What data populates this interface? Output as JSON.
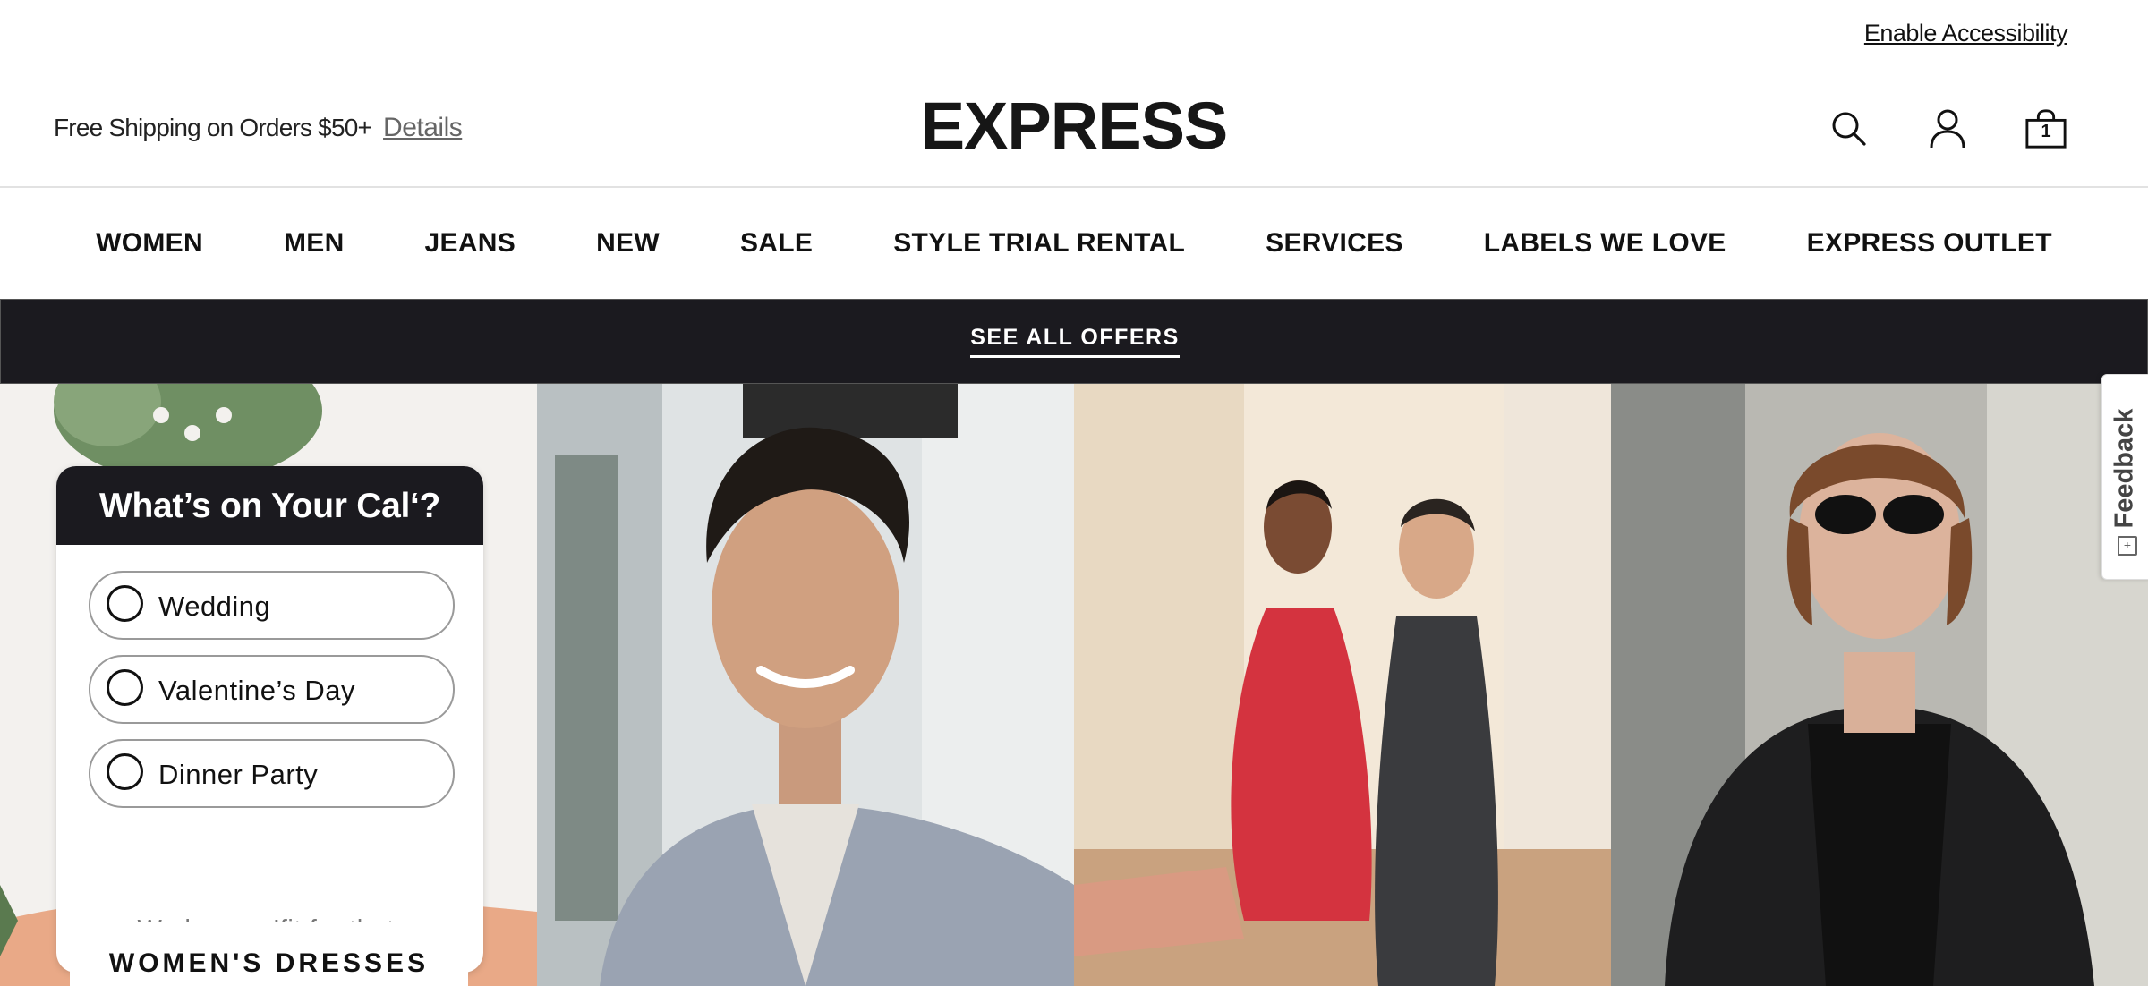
{
  "utility": {
    "enable_accessibility": "Enable Accessibility"
  },
  "header": {
    "shipping_text": "Free Shipping on Orders $50+",
    "details_link": "Details",
    "logo": "EXPRESS",
    "icons": [
      "search-icon",
      "account-icon",
      "bag-icon"
    ],
    "bag_count": "1"
  },
  "nav": {
    "items": [
      "WOMEN",
      "MEN",
      "JEANS",
      "NEW",
      "SALE",
      "STYLE TRIAL RENTAL",
      "SERVICES",
      "LABELS WE LOVE",
      "EXPRESS OUTLET"
    ]
  },
  "offers_bar": {
    "link": "SEE ALL OFFERS"
  },
  "quiz": {
    "title": "What’s on Your Cal‘?",
    "options": [
      "Wedding",
      "Valentine’s Day",
      "Dinner Party"
    ],
    "footer": "We have a ’fit for that."
  },
  "tiles": {
    "first_label": "WOMEN'S DRESSES"
  },
  "feedback": {
    "label": "Feedback"
  },
  "colors": {
    "dark_bar": "#1b1a1f",
    "text": "#111111",
    "muted": "#777777"
  }
}
